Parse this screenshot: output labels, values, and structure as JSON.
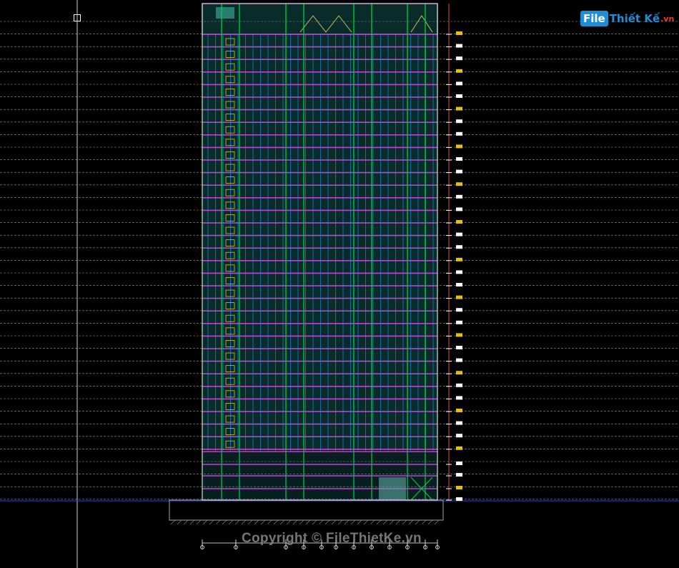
{
  "logo": {
    "box": "File",
    "text": "Thiết Kế",
    "suffix": ".vn"
  },
  "watermark": "Copyright © FileThietKe.vn",
  "colors": {
    "background": "#000000",
    "facade": "#1a7f7a",
    "floor_slab": "#c040d0",
    "grid_line": "#20a0ff",
    "structure": "#00d040",
    "accent": "#e0c020",
    "dim_line": "#ffffff",
    "ground_line": "#3040ff"
  },
  "icons": {
    "cursor": "crosshair-box-icon"
  }
}
